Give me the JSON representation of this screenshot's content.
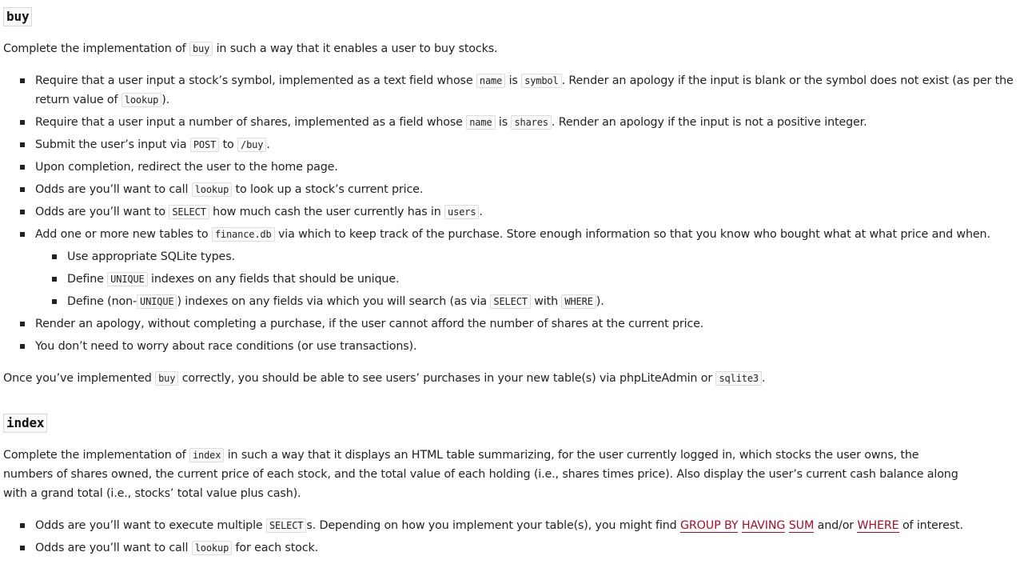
{
  "buy": {
    "heading": "buy",
    "intro": {
      "t1": "Complete the implementation of ",
      "c1": "buy",
      "t2": " in such a way that it enables a user to buy stocks."
    },
    "b1": {
      "t1": "Require that a user input a stock’s symbol, implemented as a text field whose ",
      "c1": "name",
      "t2": " is ",
      "c2": "symbol",
      "t3": ". Render an apology if the input is blank or the symbol does not exist (as per the return value of ",
      "c3": "lookup",
      "t4": ")."
    },
    "b2": {
      "t1": "Require that a user input a number of shares, implemented as a field whose ",
      "c1": "name",
      "t2": " is ",
      "c2": "shares",
      "t3": ". Render an apology if the input is not a positive integer."
    },
    "b3": {
      "t1": "Submit the user’s input via ",
      "c1": "POST",
      "t2": " to ",
      "c2": "/buy",
      "t3": "."
    },
    "b4": {
      "t1": "Upon completion, redirect the user to the home page."
    },
    "b5": {
      "t1": "Odds are you’ll want to call ",
      "c1": "lookup",
      "t2": " to look up a stock’s current price."
    },
    "b6": {
      "t1": "Odds are you’ll want to ",
      "c1": "SELECT",
      "t2": " how much cash the user currently has in ",
      "c2": "users",
      "t3": "."
    },
    "b7": {
      "t1": "Add one or more new tables to ",
      "c1": "finance.db",
      "t2": " via which to keep track of the purchase. Store enough information so that you know who bought what at what price and when."
    },
    "s1": {
      "t1": "Use appropriate SQLite types."
    },
    "s2": {
      "t1": "Define ",
      "c1": "UNIQUE",
      "t2": " indexes on any fields that should be unique."
    },
    "s3": {
      "t1": "Define (non-",
      "c1": "UNIQUE",
      "t2": ") indexes on any fields via which you will search (as via ",
      "c2": "SELECT",
      "t3": " with ",
      "c3": "WHERE",
      "t4": ")."
    },
    "b8": {
      "t1": "Render an apology, without completing a purchase, if the user cannot afford the number of shares at the current price."
    },
    "b9": {
      "t1": "You don’t need to worry about race conditions (or use transactions)."
    },
    "outro": {
      "t1": "Once you’ve implemented ",
      "c1": "buy",
      "t2": " correctly, you should be able to see users’ purchases in your new table(s) via phpLiteAdmin or ",
      "c2": "sqlite3",
      "t3": "."
    }
  },
  "index": {
    "heading": "index",
    "intro": {
      "t1": "Complete the implementation of ",
      "c1": "index",
      "t2": " in such a way that it displays an HTML table summarizing, for the user currently logged in, which stocks the user owns, the numbers of shares owned, the current price of each stock, and the total value of each holding (i.e., shares times price). Also display the user’s current cash balance along with a grand total (i.e., stocks’ total value plus cash)."
    },
    "b1": {
      "t1": "Odds are you’ll want to execute multiple ",
      "c1": "SELECT",
      "t2": "s. Depending on how you implement your table(s), you might find ",
      "l1": "GROUP BY",
      "t3": " ",
      "l2": "HAVING",
      "t4": " ",
      "l3": "SUM",
      "t5": " and/or ",
      "l4": "WHERE",
      "t6": " of interest."
    },
    "b2": {
      "t1": "Odds are you’ll want to call ",
      "c1": "lookup",
      "t2": " for each stock."
    }
  },
  "colors": {
    "link": "#a0102a",
    "text": "#222222",
    "code_border": "#dcdcdc"
  }
}
